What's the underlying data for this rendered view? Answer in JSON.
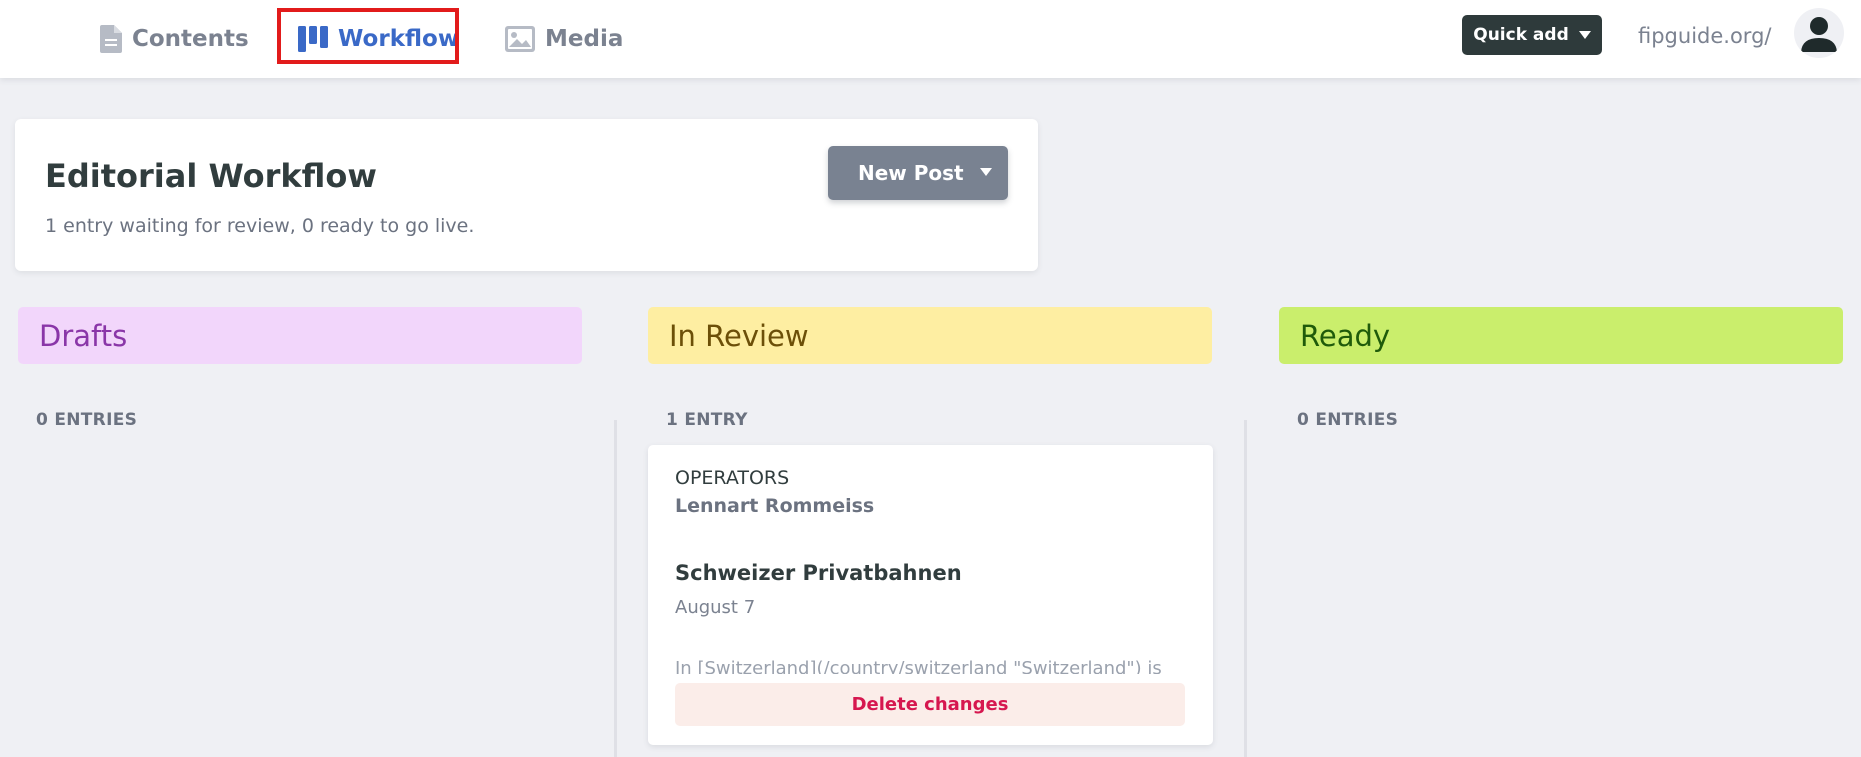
{
  "nav": {
    "contents_label": "Contents",
    "workflow_label": "Workflow",
    "media_label": "Media",
    "active": "workflow"
  },
  "topbar": {
    "quick_add_label": "Quick add",
    "site_url": "fipguide.org/"
  },
  "header": {
    "title": "Editorial Workflow",
    "subtitle": "1 entry waiting for review, 0 ready to go live.",
    "new_post_label": "New Post"
  },
  "columns": [
    {
      "label": "Drafts",
      "count": "0 ENTRIES",
      "color": "#f2d6fb",
      "text_color": "#8a36a8"
    },
    {
      "label": "In Review",
      "count": "1 ENTRY",
      "color": "#feeea2",
      "text_color": "#6c4f08"
    },
    {
      "label": "Ready",
      "count": "0 ENTRIES",
      "color": "#caee6c",
      "text_color": "#1f5b0a"
    }
  ],
  "entry": {
    "collection": "OPERATORS",
    "author": "Lennart Rommeiss",
    "title": "Schweizer Privatbahnen",
    "date": "August 7",
    "excerpt": "In [Switzerland](/country/switzerland \"Switzerland\") is",
    "delete_label": "Delete changes"
  },
  "icons": {
    "contents": "document-icon",
    "workflow": "kanban-icon",
    "media": "image-icon",
    "avatar": "user-avatar-icon"
  },
  "colors": {
    "accent": "#3a69c7",
    "highlight": "#e21b1b",
    "delete": "#d6174f"
  }
}
